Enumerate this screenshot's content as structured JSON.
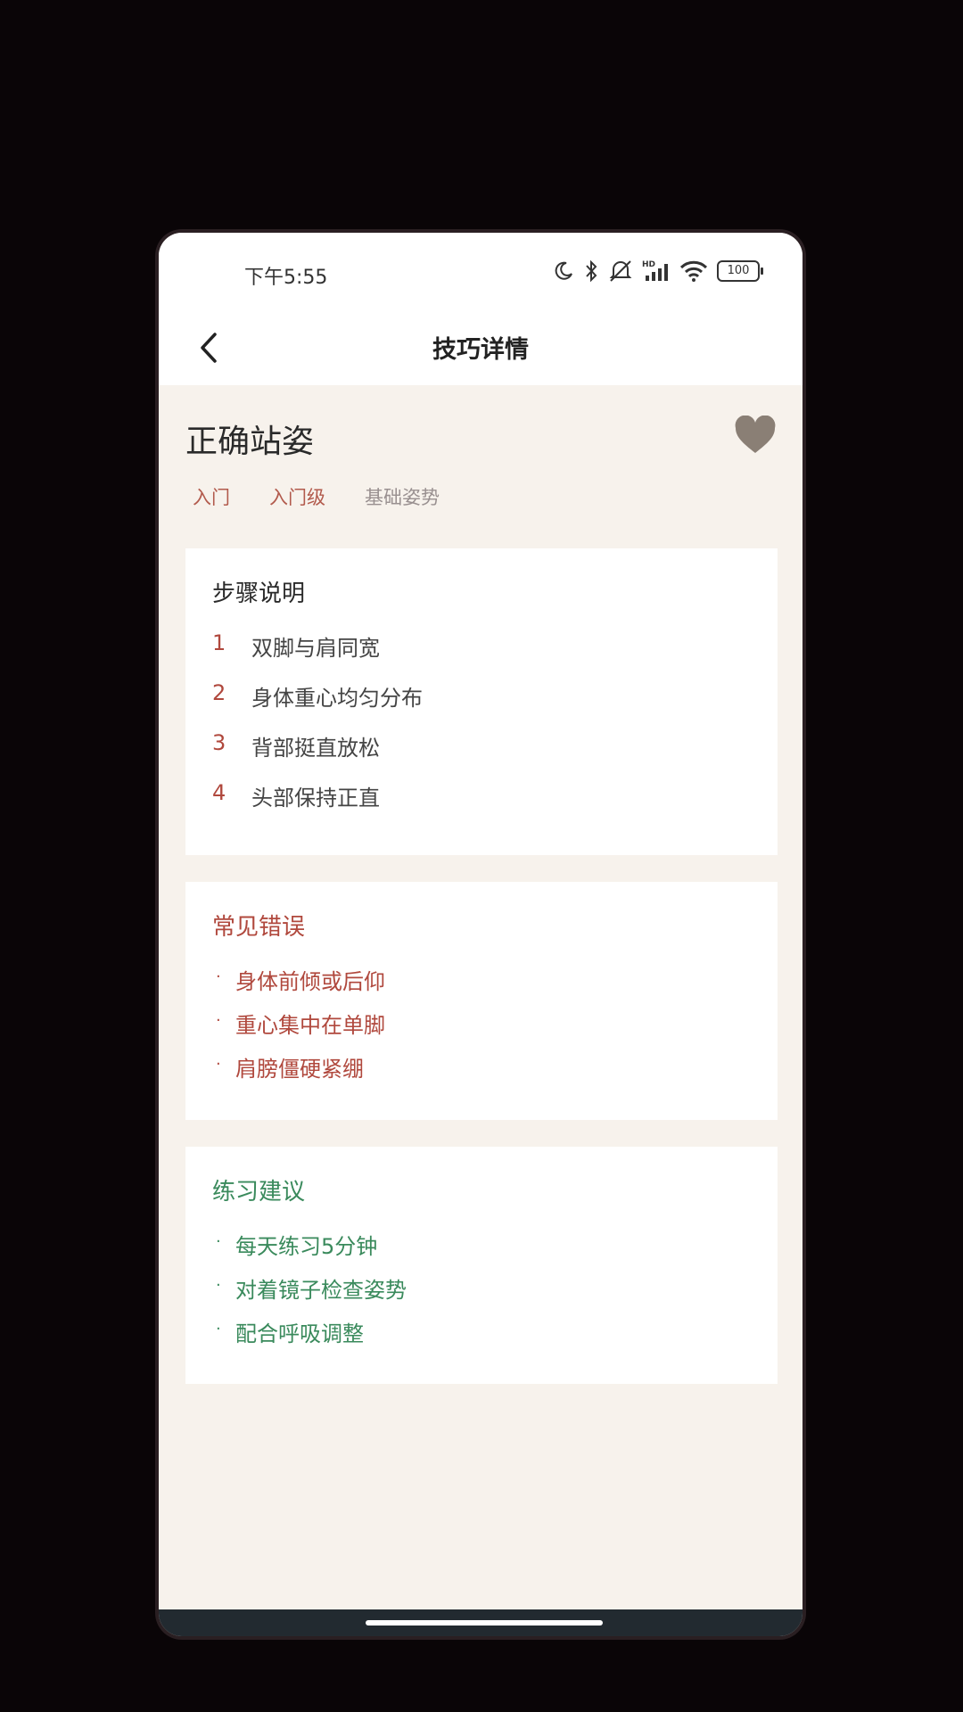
{
  "status_bar": {
    "time": "下午5:55",
    "battery": "100",
    "icons": [
      "moon-icon",
      "bluetooth-icon",
      "mute-icon",
      "signal-icon",
      "wifi-icon",
      "battery-icon"
    ]
  },
  "app_bar": {
    "title": "技巧详情"
  },
  "skill": {
    "title": "正确站姿",
    "tags": [
      "入门",
      "入门级",
      "基础姿势"
    ]
  },
  "steps": {
    "title": "步骤说明",
    "items": [
      {
        "num": "1",
        "text": "双脚与肩同宽"
      },
      {
        "num": "2",
        "text": "身体重心均匀分布"
      },
      {
        "num": "3",
        "text": "背部挺直放松"
      },
      {
        "num": "4",
        "text": "头部保持正直"
      }
    ]
  },
  "mistakes": {
    "title": "常见错误",
    "bullet": "·",
    "items": [
      "身体前倾或后仰",
      "重心集中在单脚",
      "肩膀僵硬紧绷"
    ]
  },
  "tips": {
    "title": "练习建议",
    "bullet": "·",
    "items": [
      "每天练习5分钟",
      "对着镜子检查姿势",
      "配合呼吸调整"
    ]
  },
  "colors": {
    "accent_red": "#b0483d",
    "accent_green": "#3a8a5c",
    "background": "#f7f2ec",
    "favorite": "#8a7f75"
  }
}
